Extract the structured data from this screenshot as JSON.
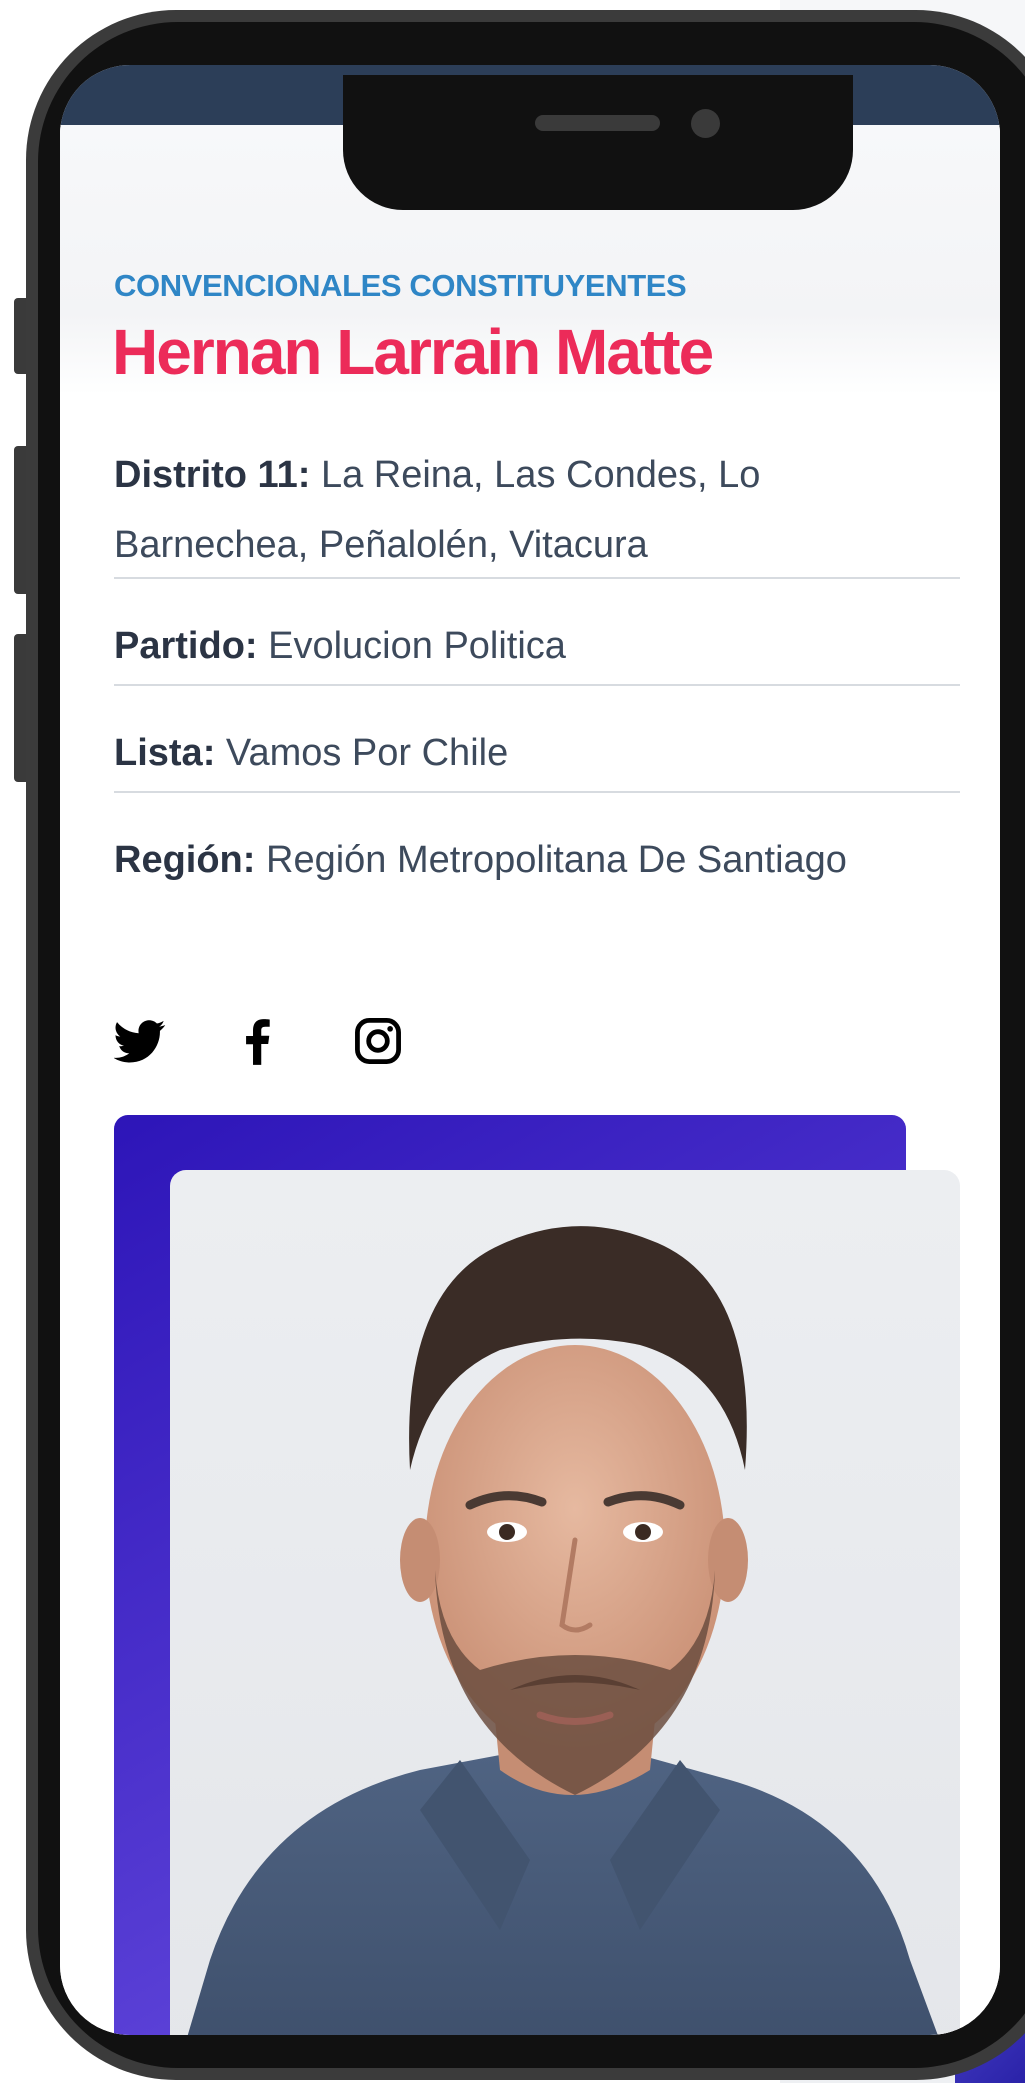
{
  "profile": {
    "category": "CONVENCIONALES CONSTITUYENTES",
    "name": "Hernan Larrain Matte",
    "district_label": "Distrito 11:",
    "district_value": " La Reina, Las Condes, Lo Barnechea, Peñalolén, Vitacura",
    "party_label": "Partido:",
    "party_value": " Evolucion Politica",
    "list_label": "Lista:",
    "list_value": " Vamos Por Chile",
    "region_label": "Región:",
    "region_value": " Región Metropolitana De Santiago"
  },
  "social": [
    {
      "icon": "twitter-icon"
    },
    {
      "icon": "facebook-icon"
    },
    {
      "icon": "instagram-icon"
    }
  ],
  "colors": {
    "category": "#2f86c6",
    "name": "#ec2b59",
    "label": "#2b3444",
    "value": "#3d4a5c",
    "photo_accent": "#4b31cc"
  }
}
